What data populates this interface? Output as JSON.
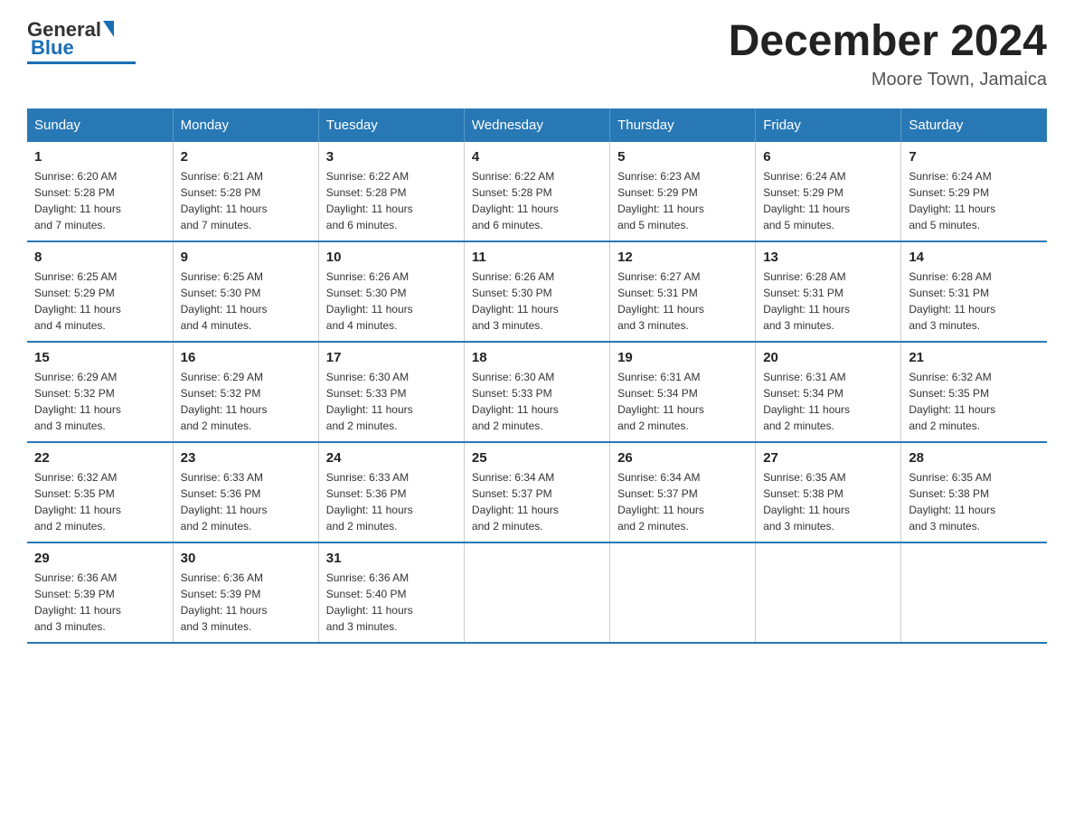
{
  "header": {
    "logo_general": "General",
    "logo_blue": "Blue",
    "month_title": "December 2024",
    "location": "Moore Town, Jamaica"
  },
  "days_of_week": [
    "Sunday",
    "Monday",
    "Tuesday",
    "Wednesday",
    "Thursday",
    "Friday",
    "Saturday"
  ],
  "weeks": [
    [
      {
        "day": "1",
        "sunrise": "6:20 AM",
        "sunset": "5:28 PM",
        "daylight": "11 hours and 7 minutes."
      },
      {
        "day": "2",
        "sunrise": "6:21 AM",
        "sunset": "5:28 PM",
        "daylight": "11 hours and 7 minutes."
      },
      {
        "day": "3",
        "sunrise": "6:22 AM",
        "sunset": "5:28 PM",
        "daylight": "11 hours and 6 minutes."
      },
      {
        "day": "4",
        "sunrise": "6:22 AM",
        "sunset": "5:28 PM",
        "daylight": "11 hours and 6 minutes."
      },
      {
        "day": "5",
        "sunrise": "6:23 AM",
        "sunset": "5:29 PM",
        "daylight": "11 hours and 5 minutes."
      },
      {
        "day": "6",
        "sunrise": "6:24 AM",
        "sunset": "5:29 PM",
        "daylight": "11 hours and 5 minutes."
      },
      {
        "day": "7",
        "sunrise": "6:24 AM",
        "sunset": "5:29 PM",
        "daylight": "11 hours and 5 minutes."
      }
    ],
    [
      {
        "day": "8",
        "sunrise": "6:25 AM",
        "sunset": "5:29 PM",
        "daylight": "11 hours and 4 minutes."
      },
      {
        "day": "9",
        "sunrise": "6:25 AM",
        "sunset": "5:30 PM",
        "daylight": "11 hours and 4 minutes."
      },
      {
        "day": "10",
        "sunrise": "6:26 AM",
        "sunset": "5:30 PM",
        "daylight": "11 hours and 4 minutes."
      },
      {
        "day": "11",
        "sunrise": "6:26 AM",
        "sunset": "5:30 PM",
        "daylight": "11 hours and 3 minutes."
      },
      {
        "day": "12",
        "sunrise": "6:27 AM",
        "sunset": "5:31 PM",
        "daylight": "11 hours and 3 minutes."
      },
      {
        "day": "13",
        "sunrise": "6:28 AM",
        "sunset": "5:31 PM",
        "daylight": "11 hours and 3 minutes."
      },
      {
        "day": "14",
        "sunrise": "6:28 AM",
        "sunset": "5:31 PM",
        "daylight": "11 hours and 3 minutes."
      }
    ],
    [
      {
        "day": "15",
        "sunrise": "6:29 AM",
        "sunset": "5:32 PM",
        "daylight": "11 hours and 3 minutes."
      },
      {
        "day": "16",
        "sunrise": "6:29 AM",
        "sunset": "5:32 PM",
        "daylight": "11 hours and 2 minutes."
      },
      {
        "day": "17",
        "sunrise": "6:30 AM",
        "sunset": "5:33 PM",
        "daylight": "11 hours and 2 minutes."
      },
      {
        "day": "18",
        "sunrise": "6:30 AM",
        "sunset": "5:33 PM",
        "daylight": "11 hours and 2 minutes."
      },
      {
        "day": "19",
        "sunrise": "6:31 AM",
        "sunset": "5:34 PM",
        "daylight": "11 hours and 2 minutes."
      },
      {
        "day": "20",
        "sunrise": "6:31 AM",
        "sunset": "5:34 PM",
        "daylight": "11 hours and 2 minutes."
      },
      {
        "day": "21",
        "sunrise": "6:32 AM",
        "sunset": "5:35 PM",
        "daylight": "11 hours and 2 minutes."
      }
    ],
    [
      {
        "day": "22",
        "sunrise": "6:32 AM",
        "sunset": "5:35 PM",
        "daylight": "11 hours and 2 minutes."
      },
      {
        "day": "23",
        "sunrise": "6:33 AM",
        "sunset": "5:36 PM",
        "daylight": "11 hours and 2 minutes."
      },
      {
        "day": "24",
        "sunrise": "6:33 AM",
        "sunset": "5:36 PM",
        "daylight": "11 hours and 2 minutes."
      },
      {
        "day": "25",
        "sunrise": "6:34 AM",
        "sunset": "5:37 PM",
        "daylight": "11 hours and 2 minutes."
      },
      {
        "day": "26",
        "sunrise": "6:34 AM",
        "sunset": "5:37 PM",
        "daylight": "11 hours and 2 minutes."
      },
      {
        "day": "27",
        "sunrise": "6:35 AM",
        "sunset": "5:38 PM",
        "daylight": "11 hours and 3 minutes."
      },
      {
        "day": "28",
        "sunrise": "6:35 AM",
        "sunset": "5:38 PM",
        "daylight": "11 hours and 3 minutes."
      }
    ],
    [
      {
        "day": "29",
        "sunrise": "6:36 AM",
        "sunset": "5:39 PM",
        "daylight": "11 hours and 3 minutes."
      },
      {
        "day": "30",
        "sunrise": "6:36 AM",
        "sunset": "5:39 PM",
        "daylight": "11 hours and 3 minutes."
      },
      {
        "day": "31",
        "sunrise": "6:36 AM",
        "sunset": "5:40 PM",
        "daylight": "11 hours and 3 minutes."
      },
      null,
      null,
      null,
      null
    ]
  ],
  "labels": {
    "sunrise": "Sunrise:",
    "sunset": "Sunset:",
    "daylight": "Daylight:"
  }
}
